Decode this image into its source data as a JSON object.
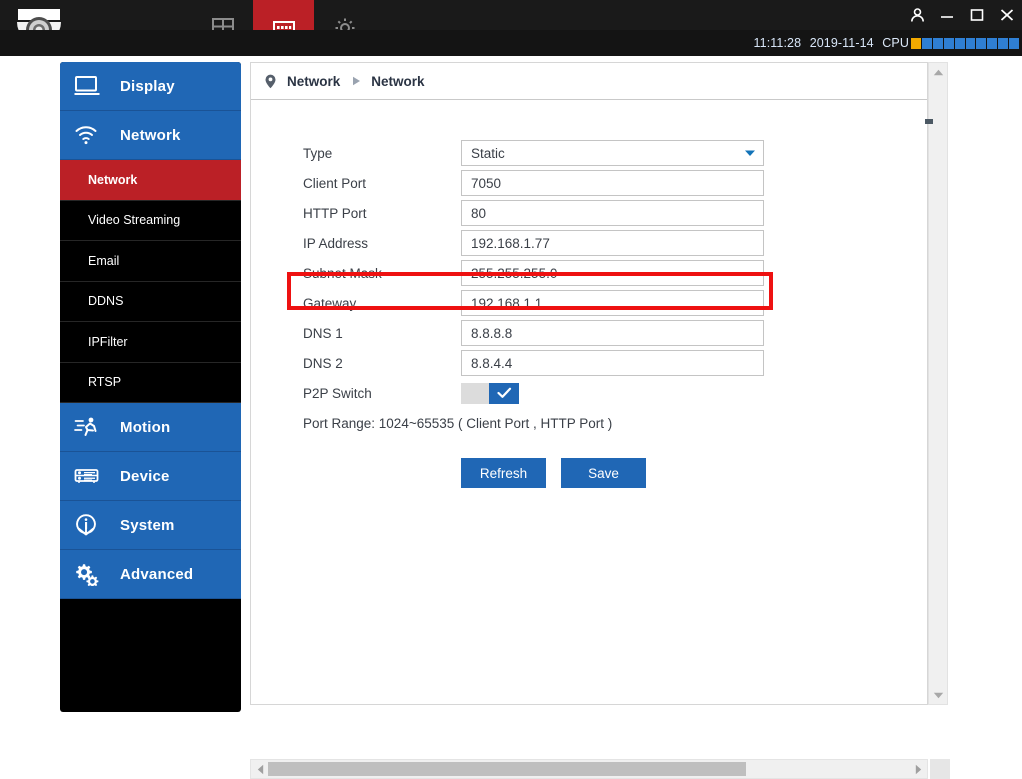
{
  "titlebar": {
    "logo_icon": "dome-camera-icon",
    "tabs": [
      {
        "id": "layout",
        "icon": "grid-layout-icon",
        "active": false
      },
      {
        "id": "playback",
        "icon": "device-panel-icon",
        "active": true
      },
      {
        "id": "settings",
        "icon": "gear-icon",
        "active": false
      }
    ],
    "window_controls": [
      {
        "id": "user",
        "icon": "user-icon"
      },
      {
        "id": "minimize",
        "icon": "minimize-icon"
      },
      {
        "id": "maximize",
        "icon": "maximize-icon"
      },
      {
        "id": "close",
        "icon": "close-icon"
      }
    ]
  },
  "statusbar": {
    "time": "11:11:28",
    "date": "2019-11-14",
    "cpu_label": "CPU",
    "cpu_bars_total": 10,
    "cpu_bars_warn": 1,
    "cpu_warn_color": "#f2a900",
    "cpu_bar_color": "#2f7fd4"
  },
  "sidebar": {
    "groups": [
      {
        "label": "Display",
        "icon": "monitor-icon",
        "active": false,
        "children": []
      },
      {
        "label": "Network",
        "icon": "wifi-icon",
        "active": true,
        "children": [
          {
            "label": "Network",
            "active": true
          },
          {
            "label": "Video Streaming",
            "active": false
          },
          {
            "label": "Email",
            "active": false
          },
          {
            "label": "DDNS",
            "active": false
          },
          {
            "label": "IPFilter",
            "active": false
          },
          {
            "label": "RTSP",
            "active": false
          }
        ]
      },
      {
        "label": "Motion",
        "icon": "running-person-icon",
        "active": false,
        "children": []
      },
      {
        "label": "Device",
        "icon": "server-rack-icon",
        "active": false,
        "children": []
      },
      {
        "label": "System",
        "icon": "info-pin-icon",
        "active": false,
        "children": []
      },
      {
        "label": "Advanced",
        "icon": "gears-icon",
        "active": false,
        "children": []
      }
    ]
  },
  "content": {
    "breadcrumb": {
      "pin_icon": "location-pin-icon",
      "separator_icon": "triangle-right-icon",
      "first": "Network",
      "second": "Network"
    },
    "form": {
      "type": {
        "label": "Type",
        "value": "Static",
        "caret_icon": "chevron-down-icon"
      },
      "client_port": {
        "label": "Client Port",
        "value": "7050"
      },
      "http_port": {
        "label": "HTTP Port",
        "value": "80"
      },
      "ip_address": {
        "label": "IP Address",
        "value": "192.168.1.77"
      },
      "subnet_mask": {
        "label": "Subnet Mask",
        "value": "255.255.255.0"
      },
      "gateway": {
        "label": "Gateway",
        "value": "192.168.1.1"
      },
      "dns1": {
        "label": "DNS 1",
        "value": "8.8.8.8"
      },
      "dns2": {
        "label": "DNS 2",
        "value": "8.8.4.4"
      },
      "p2p_switch": {
        "label": "P2P Switch",
        "state": "on",
        "check_icon": "check-icon"
      },
      "port_range_note": "Port Range: 1024~65535 ( Client Port , HTTP Port )"
    },
    "buttons": {
      "refresh": "Refresh",
      "save": "Save"
    }
  },
  "annotation": {
    "target": "ip-address-row",
    "color": "#ee1111"
  },
  "scrollbars": {
    "vertical": {
      "up_icon": "triangle-up-icon",
      "down_icon": "triangle-down-icon"
    },
    "horizontal": {
      "left_icon": "triangle-left-icon",
      "right_icon": "triangle-right-icon"
    }
  },
  "theme": {
    "accent_blue": "#2067b5",
    "accent_red": "#bb2026",
    "titlebar_bg": "#1a1a1a",
    "sidebar_bg": "#000000"
  }
}
